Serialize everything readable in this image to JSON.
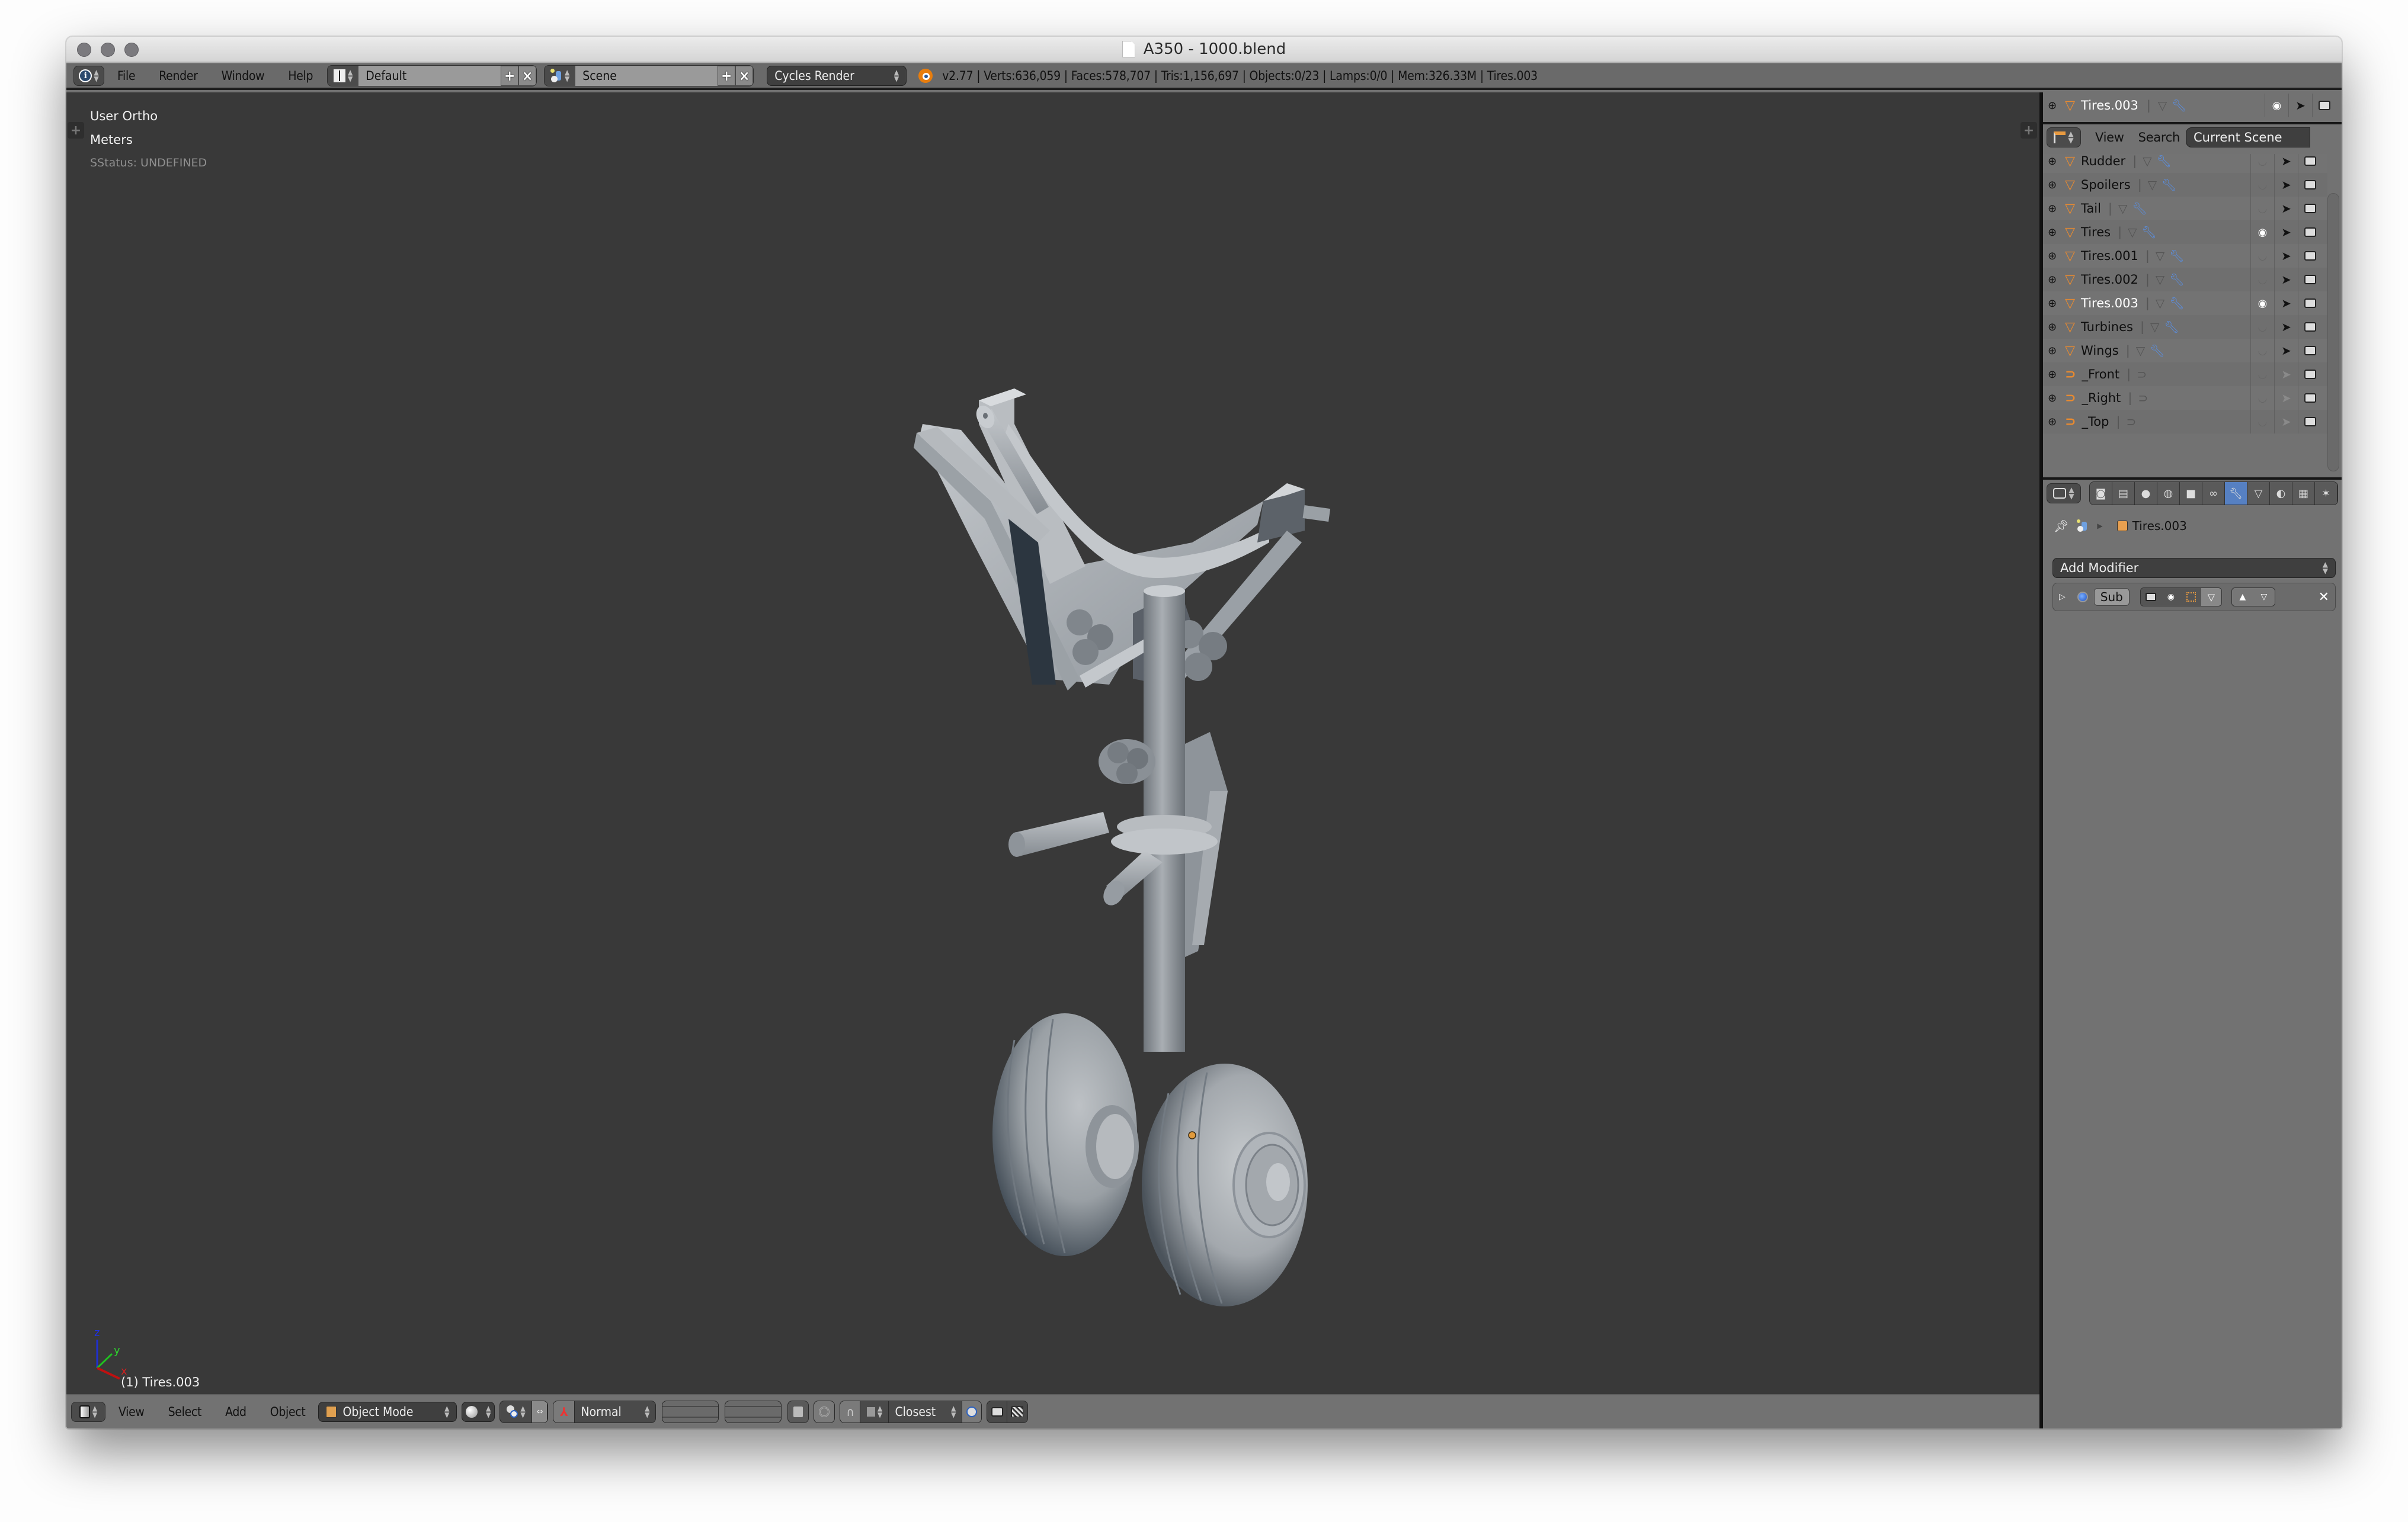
{
  "window": {
    "title": "A350 - 1000.blend",
    "traffic_lights": [
      "close",
      "minimize",
      "zoom"
    ]
  },
  "info_header": {
    "editor_icon": "info-icon",
    "menus": [
      "File",
      "Render",
      "Window",
      "Help"
    ],
    "screen_layout": {
      "icon": "layout-icon",
      "value": "Default"
    },
    "scene": {
      "icon": "scene-icon",
      "value": "Scene"
    },
    "render_engine": "Cycles Render",
    "stats": "v2.77 | Verts:636,059 | Faces:578,707 | Tris:1,156,697 | Objects:0/23 | Lamps:0/0 | Mem:326.33M | Tires.003"
  },
  "viewport": {
    "view_name": "User Ortho",
    "units": "Meters",
    "status": "SStatus: UNDEFINED",
    "active_object_label": "(1) Tires.003",
    "axes": {
      "x": "x",
      "y": "y",
      "z": "z"
    },
    "colors": {
      "background": "#393939",
      "model": "#a8adb2",
      "origin_dot": "#e09a3c"
    }
  },
  "viewport_header": {
    "editor_icon": "3d-view-icon",
    "menus": [
      "View",
      "Select",
      "Add",
      "Object"
    ],
    "mode": "Object Mode",
    "pivot_icon": "pivot-point-icon",
    "transform_orientation": "Normal",
    "snap_target": "Closest"
  },
  "outliner": {
    "pinned_row": {
      "name": "Tires.003",
      "visible": true
    },
    "header": {
      "editor_icon": "outliner-icon",
      "menus": [
        "View",
        "Search"
      ],
      "display_mode": "Current Scene"
    },
    "rows": [
      {
        "name": "Rudder",
        "type": "mesh",
        "visible": false,
        "selectable": true,
        "has_modifier": true
      },
      {
        "name": "Spoilers",
        "type": "mesh",
        "visible": false,
        "selectable": true,
        "has_modifier": true
      },
      {
        "name": "Tail",
        "type": "mesh",
        "visible": false,
        "selectable": true,
        "has_modifier": true
      },
      {
        "name": "Tires",
        "type": "mesh",
        "visible": true,
        "selectable": true,
        "has_modifier": true
      },
      {
        "name": "Tires.001",
        "type": "mesh",
        "visible": false,
        "selectable": true,
        "has_modifier": true
      },
      {
        "name": "Tires.002",
        "type": "mesh",
        "visible": false,
        "selectable": true,
        "has_modifier": true
      },
      {
        "name": "Tires.003",
        "type": "mesh",
        "visible": true,
        "selectable": true,
        "has_modifier": true,
        "active": true
      },
      {
        "name": "Turbines",
        "type": "mesh",
        "visible": false,
        "selectable": true,
        "has_modifier": true
      },
      {
        "name": "Wings",
        "type": "mesh",
        "visible": false,
        "selectable": true,
        "has_modifier": true
      },
      {
        "name": "_Front",
        "type": "curve",
        "visible": false,
        "selectable": false,
        "has_modifier": false
      },
      {
        "name": "_Right",
        "type": "curve",
        "visible": false,
        "selectable": false,
        "has_modifier": false
      },
      {
        "name": "_Top",
        "type": "curve",
        "visible": false,
        "selectable": false,
        "has_modifier": false
      }
    ]
  },
  "properties": {
    "tabs": [
      "render",
      "render-layers",
      "scene",
      "world",
      "object",
      "constraints",
      "modifiers",
      "data",
      "material",
      "texture",
      "particles"
    ],
    "active_tab": "modifiers",
    "breadcrumb": {
      "object": "Tires.003"
    },
    "add_modifier_label": "Add Modifier",
    "modifier": {
      "name": "Sub",
      "expanded": false
    }
  }
}
